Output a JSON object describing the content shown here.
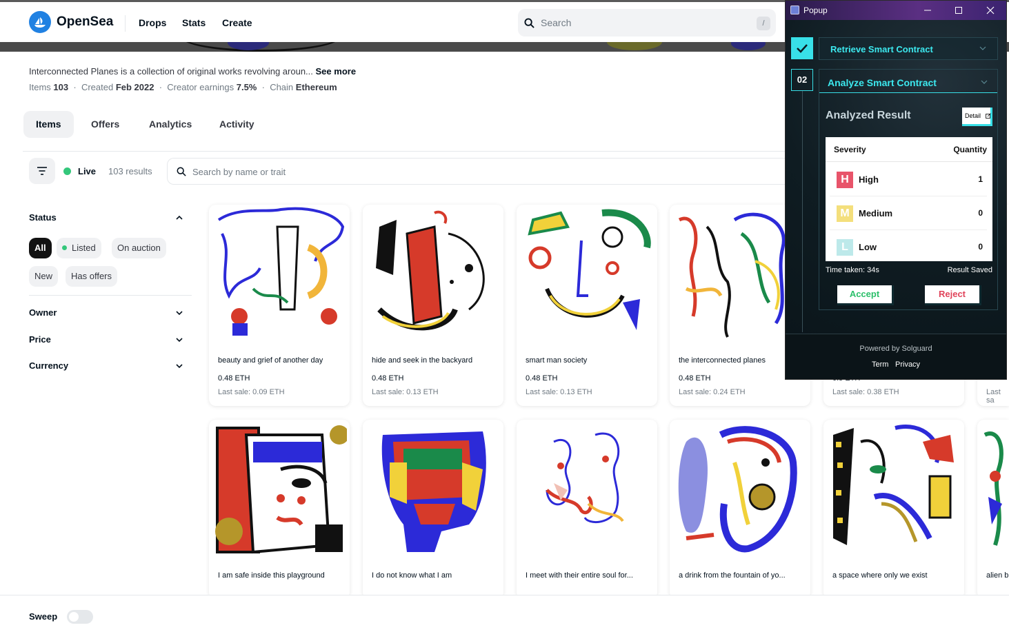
{
  "header": {
    "brand": "OpenSea",
    "nav": [
      "Drops",
      "Stats",
      "Create"
    ],
    "search_placeholder": "Search",
    "search_shortcut": "/"
  },
  "collection": {
    "description": "Interconnected Planes is a collection of original works revolving aroun...",
    "see_more": "See more",
    "items_label": "Items",
    "items_value": "103",
    "created_label": "Created",
    "created_value": "Feb 2022",
    "earnings_label": "Creator earnings",
    "earnings_value": "7.5%",
    "chain_label": "Chain",
    "chain_value": "Ethereum",
    "sep": "·"
  },
  "tabs": [
    "Items",
    "Offers",
    "Analytics",
    "Activity"
  ],
  "toolbar": {
    "live": "Live",
    "results": "103 results",
    "search_placeholder": "Search by name or trait"
  },
  "sidebar": {
    "status": "Status",
    "pills": [
      "All",
      "Listed",
      "On auction",
      "New",
      "Has offers"
    ],
    "sections": [
      "Owner",
      "Price",
      "Currency"
    ]
  },
  "cards": [
    {
      "title": "beauty and grief of another day",
      "price": "0.48 ETH",
      "last_sale": "Last sale: 0.09 ETH"
    },
    {
      "title": "hide and seek in the backyard",
      "price": "0.48 ETH",
      "last_sale": "Last sale: 0.13 ETH"
    },
    {
      "title": "smart man society",
      "price": "0.48 ETH",
      "last_sale": "Last sale: 0.13 ETH"
    },
    {
      "title": "the interconnected planes",
      "price": "0.48 ETH",
      "last_sale": "Last sale: 0.24 ETH"
    },
    {
      "title": "",
      "price": "0.5 ETH",
      "last_sale": "Last sale: 0.38 ETH"
    },
    {
      "title": "",
      "price": "",
      "last_sale": "Last sa"
    },
    {
      "title": "I am safe inside this playground",
      "price": "",
      "last_sale": ""
    },
    {
      "title": "I do not know what I am",
      "price": "",
      "last_sale": ""
    },
    {
      "title": "I meet with their entire soul for...",
      "price": "",
      "last_sale": ""
    },
    {
      "title": "a drink from the fountain of yo...",
      "price": "",
      "last_sale": ""
    },
    {
      "title": "a space where only we exist",
      "price": "",
      "last_sale": ""
    },
    {
      "title": "alien b",
      "price": "",
      "last_sale": ""
    }
  ],
  "footer": {
    "sweep": "Sweep"
  },
  "popup": {
    "title": "Popup",
    "step1_label": "Retrieve Smart Contract",
    "step2_num": "02",
    "step2_label": "Analyze Smart Contract",
    "result_title": "Analyzed Result",
    "detail": "Detail",
    "table_headers": [
      "Severity",
      "Quantity"
    ],
    "rows": [
      {
        "letter": "H",
        "name": "High",
        "qty": "1",
        "color": "#e8546a"
      },
      {
        "letter": "M",
        "name": "Medium",
        "qty": "0",
        "color": "#f4df7c"
      },
      {
        "letter": "L",
        "name": "Low",
        "qty": "0",
        "color": "#bde9ea"
      }
    ],
    "time_taken": "Time taken: 34s",
    "result_saved": "Result Saved",
    "accept": "Accept",
    "reject": "Reject",
    "powered": "Powered by Solguard",
    "links": [
      "Term",
      "Privacy"
    ],
    "accent_color": "#3ce9ef"
  }
}
